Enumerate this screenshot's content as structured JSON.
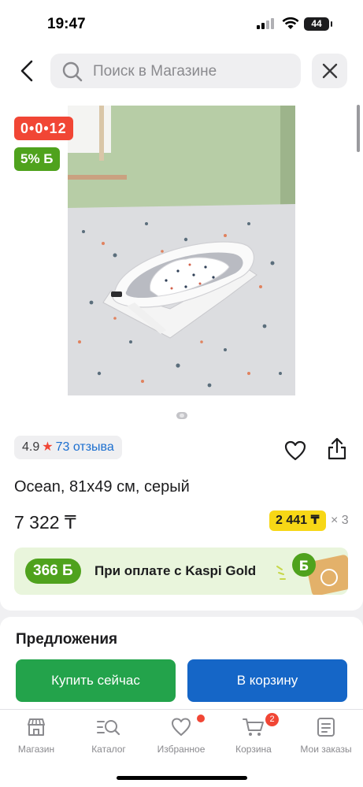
{
  "status_bar": {
    "time": "19:47",
    "battery": "44"
  },
  "search": {
    "placeholder": "Поиск в Магазине"
  },
  "badges": {
    "installment": "0•0•12",
    "bonus_percent": "5% Б"
  },
  "product": {
    "rating": "4.9",
    "reviews": "73 отзыва",
    "title": "Ocean, 81x49 см, серый",
    "price": "7 322 ₸",
    "installment_price": "2 441 ₸",
    "installment_multiplier": "× 3"
  },
  "kaspi_gold": {
    "bonus": "366 Б",
    "text": "При оплате с Kaspi Gold"
  },
  "offers": {
    "title": "Предложения",
    "buy_now": "Купить сейчас",
    "add_to_cart": "В корзину"
  },
  "tabbar": {
    "items": [
      {
        "label": "Магазин",
        "icon": "store-icon"
      },
      {
        "label": "Каталог",
        "icon": "catalog-search-icon"
      },
      {
        "label": "Избранное",
        "icon": "heart-icon"
      },
      {
        "label": "Корзина",
        "icon": "cart-icon"
      },
      {
        "label": "Мои заказы",
        "icon": "orders-icon"
      }
    ],
    "cart_count": "2"
  },
  "colors": {
    "red": "#f14635",
    "green": "#4fa21d",
    "buy": "#23a34b",
    "cart": "#1566c7",
    "yellow": "#f7d716"
  }
}
